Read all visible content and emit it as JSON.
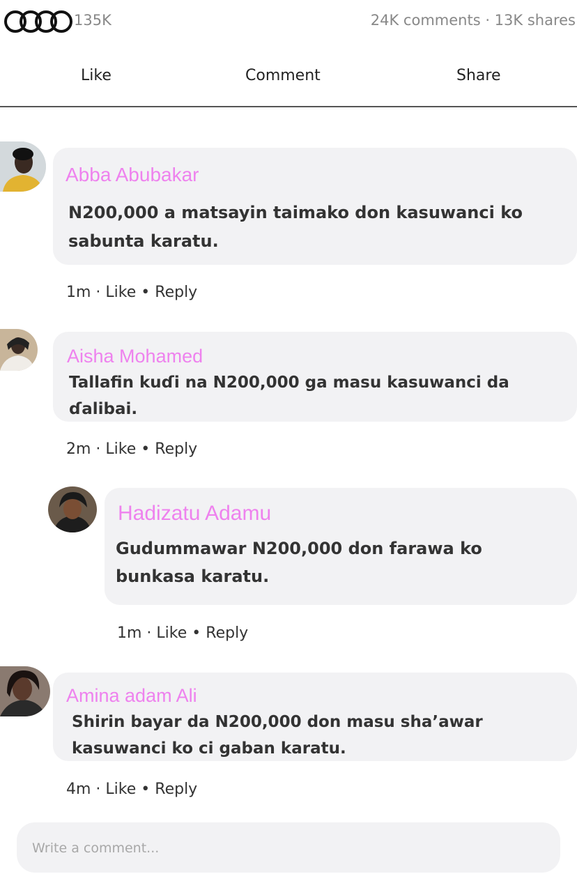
{
  "post": {
    "reaction_count": "135K",
    "stats": "24K comments · 13K shares",
    "reaction_icon": "rings-icon"
  },
  "actions": {
    "like": "Like",
    "comment": "Comment",
    "share": "Share"
  },
  "comments": [
    {
      "author": "Abba Abubakar",
      "text": "N200,000 a matsayin taimako don kasuwanci ko sabunta karatu.",
      "time": "1m",
      "like": "Like",
      "reply": "Reply"
    },
    {
      "author": "Aisha Mohamed",
      "text": "Tallafin kuɗi na N200,000 ga masu kasuwanci da ɗalibai.",
      "time": "2m",
      "like": "Like",
      "reply": "Reply"
    },
    {
      "author": "Hadizatu Adamu",
      "text": "Gudummawar N200,000 don farawa ko bunkasa karatu.",
      "time": "1m",
      "like": "Like",
      "reply": "Reply"
    },
    {
      "author": "Amina adam Ali",
      "text": "Shirin bayar da N200,000 don masu sha’awar kasuwanci ko ci gaban karatu.",
      "time": "4m",
      "like": "Like",
      "reply": "Reply"
    }
  ],
  "composer": {
    "placeholder": "Write a comment..."
  },
  "colors": {
    "author_name": "#ee82ee",
    "bubble": "#f2f2f4"
  }
}
